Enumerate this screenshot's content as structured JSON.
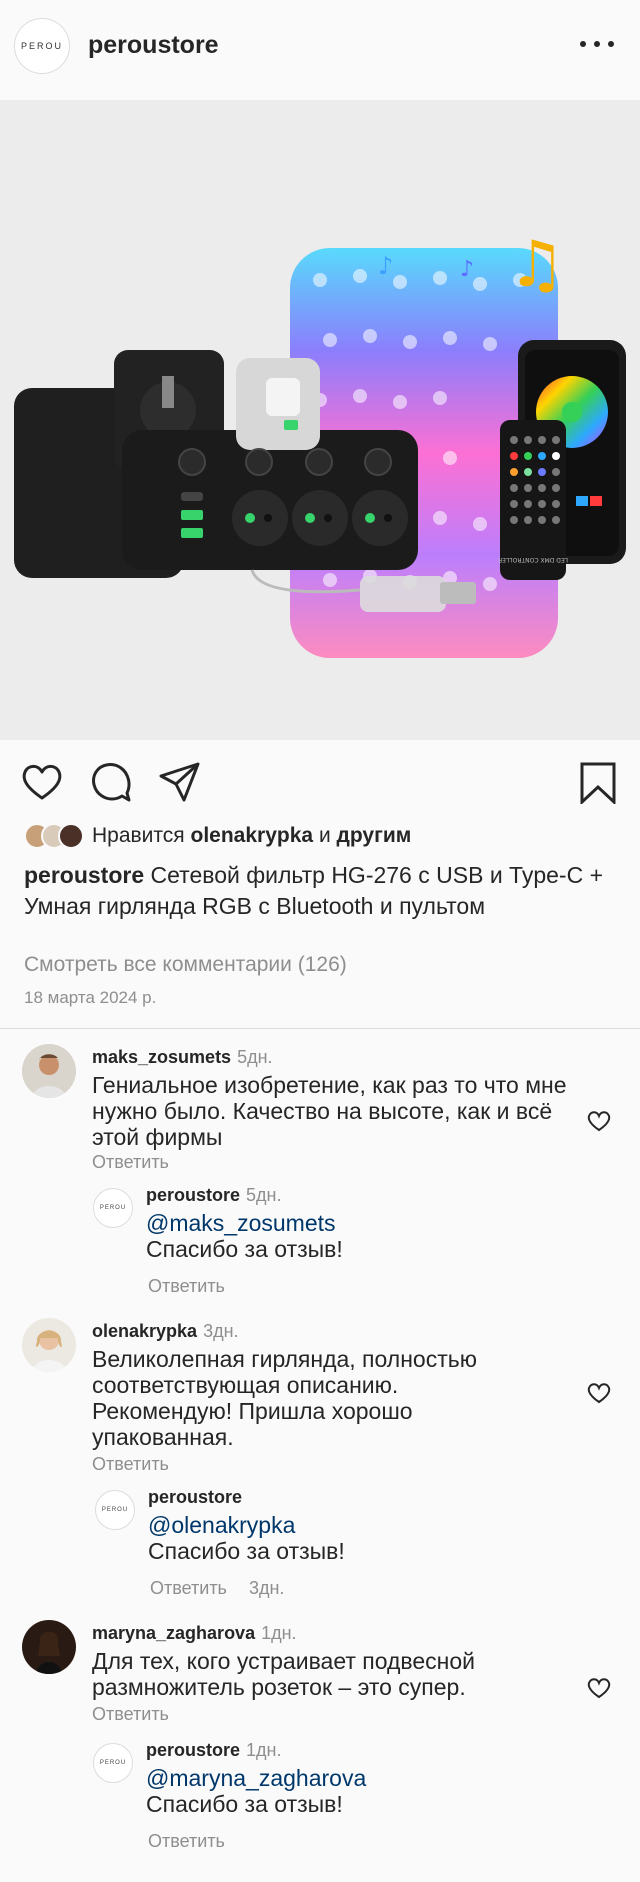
{
  "header": {
    "brand_logo_text": "PEROU",
    "username": "peroustore"
  },
  "post": {
    "likes_prefix": "Нравится",
    "likes_user": "olenakrypka",
    "likes_and": "и",
    "likes_suffix": "другим",
    "caption_user": "peroustore",
    "caption_text": "Сетевой фильтр HG-276 с USB и Type-C + Умная гирлянда RGB с Bluetooth и пультом",
    "view_all": "Смотреть все комментарии (126)",
    "date": "18 марта 2024 р."
  },
  "comments": [
    {
      "user": "maks_zosumets",
      "time": "5дн.",
      "text": "Гениальное изобретение, как раз то что мне нужно было. Качество на высоте, как и всё этой фирмы",
      "reply_label": "Ответить",
      "reply": {
        "user": "peroustore",
        "time": "5дн.",
        "mention": "@maks_zosumets",
        "text": "Спасибо за отзыв!",
        "reply_label": "Ответить",
        "reply_time": ""
      }
    },
    {
      "user": "olenakrypka",
      "time": "3дн.",
      "text": "Великолепная гирлянда, полностью соответствующая описанию. Рекомендую! Пришла хорошо упакованная.",
      "reply_label": "Ответить",
      "reply": {
        "user": "peroustore",
        "time": "",
        "mention": "@olenakrypka",
        "text": "Спасибо за отзыв!",
        "reply_label": "Ответить",
        "reply_time": "3дн."
      }
    },
    {
      "user": "maryna_zagharova",
      "time": "1дн.",
      "text": "Для тех, кого устраивает подвесной размножитель розеток – это супер.",
      "reply_label": "Ответить",
      "reply": {
        "user": "peroustore",
        "time": "1дн.",
        "mention": "@maryna_zagharova",
        "text": "Спасибо за отзыв!",
        "reply_label": "Ответить",
        "reply_time": ""
      }
    }
  ],
  "product_image": {
    "remote_label": "LED DMX CONTROLLER"
  },
  "colors": {
    "text": "#262626",
    "secondary": "#8e8e8e",
    "mention": "#00376b",
    "divider": "#dbdbdb",
    "background": "#fafafa"
  },
  "icons": [
    "more-icon",
    "heart-icon",
    "comment-icon",
    "share-icon",
    "bookmark-icon",
    "comment-like-icon"
  ]
}
